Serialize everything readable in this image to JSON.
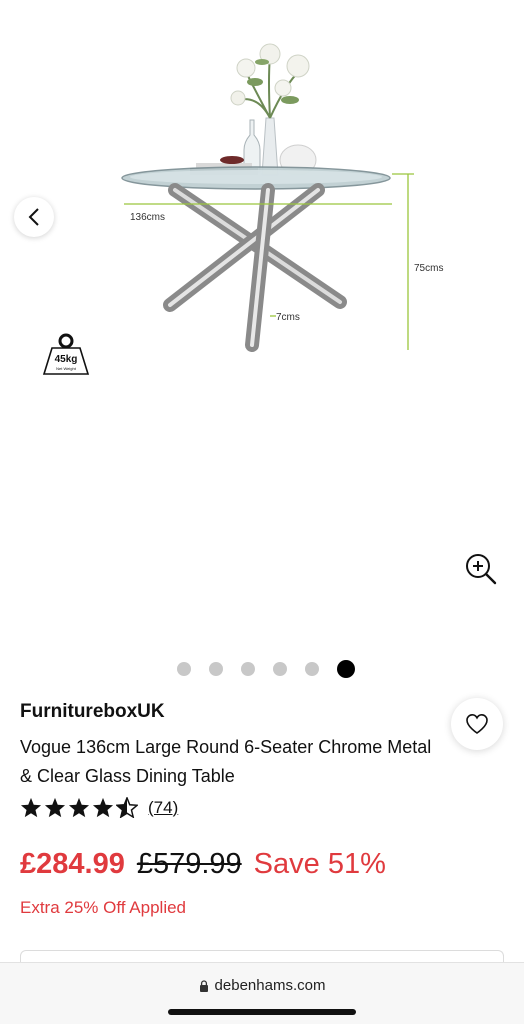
{
  "gallery": {
    "dimensions": {
      "width": "136cms",
      "height": "75cms",
      "leg": "7cms"
    },
    "weight_badge": {
      "value": "45kg",
      "label": "Net Weight"
    },
    "dots_count": 6,
    "active_dot": 5
  },
  "product": {
    "brand": "FurnitureboxUK",
    "title": "Vogue 136cm Large Round 6-Seater Chrome Metal & Clear Glass Dining Table",
    "rating": 4.5,
    "review_count": "(74)"
  },
  "pricing": {
    "now": "£284.99",
    "was": "£579.99",
    "save": "Save 51%",
    "promo": "Extra 25% Off Applied"
  },
  "browser": {
    "url": "debenhams.com"
  },
  "colors": {
    "sale": "#e03a3e",
    "dimension_line": "#9bc53d",
    "chrome": "#8a8a8a"
  }
}
